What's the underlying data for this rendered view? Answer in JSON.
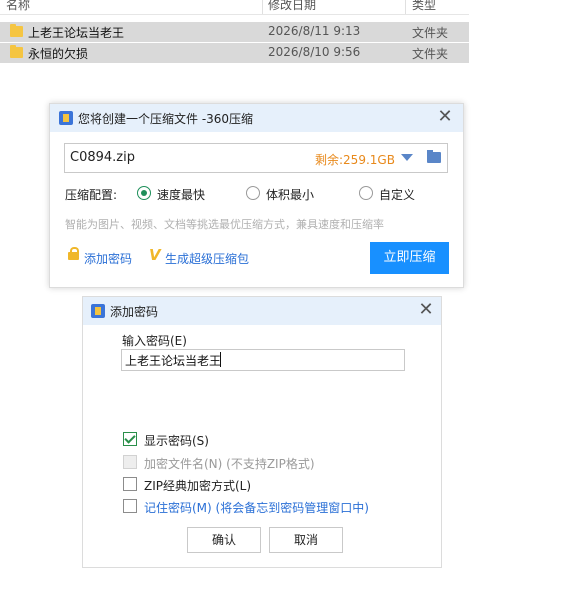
{
  "explorer": {
    "columns": {
      "name": "名称",
      "date": "修改日期",
      "type": "类型"
    },
    "rows": [
      {
        "name": "上老王论坛当老王",
        "date": "2026/8/11 9:13",
        "type": "文件夹"
      },
      {
        "name": "永恒的欠损",
        "date": "2026/8/10 9:56",
        "type": "文件夹"
      }
    ]
  },
  "compress_dialog": {
    "title": "您将创建一个压缩文件 -360压缩",
    "filename": "C0894.zip",
    "free_space": "剩余:259.1GB",
    "option_label": "压缩配置:",
    "options": [
      {
        "label": "速度最快",
        "selected": true
      },
      {
        "label": "体积最小",
        "selected": false
      },
      {
        "label": "自定义",
        "selected": false
      }
    ],
    "hint": "智能为图片、视频、文档等挑选最优压缩方式，兼具速度和压缩率",
    "add_password": "添加密码",
    "super_pack": "生成超级压缩包",
    "compress_button": "立即压缩"
  },
  "password_dialog": {
    "title": "添加密码",
    "input_label": "输入密码(E)",
    "password_value": "上老王论坛当老王",
    "checkboxes": [
      {
        "label": "显示密码(S)",
        "checked": true,
        "enabled": true
      },
      {
        "label": "加密文件名(N) (不支持ZIP格式)",
        "checked": false,
        "enabled": false
      },
      {
        "label": "ZIP经典加密方式(L)",
        "checked": false,
        "enabled": true
      },
      {
        "label": "记住密码(M) (将会备忘到密码管理窗口中)",
        "checked": false,
        "enabled": true
      }
    ],
    "ok_button": "确认",
    "cancel_button": "取消"
  },
  "colors": {
    "accent": "#1890ff",
    "link": "#2a6fd6",
    "free_space": "#e8891b",
    "title_bar": "#e6f0fb",
    "check_green": "#2a8f4a"
  }
}
